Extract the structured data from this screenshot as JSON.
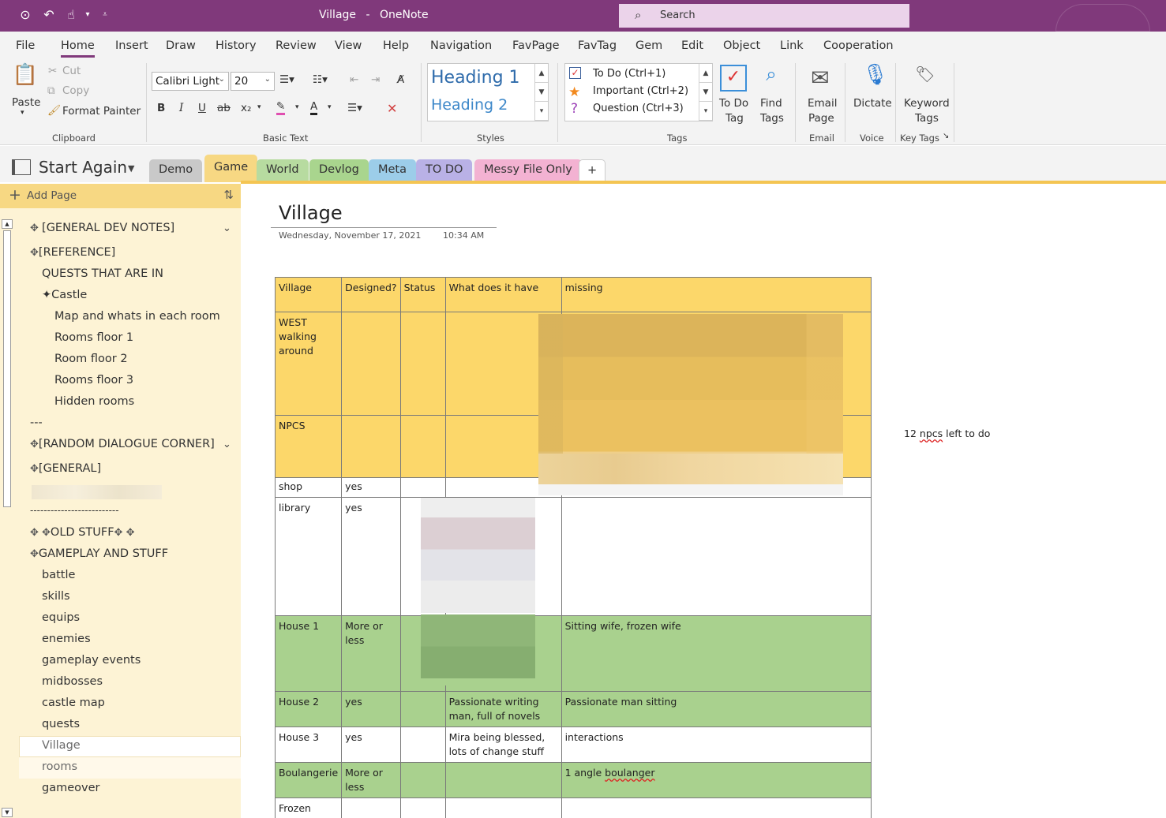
{
  "window": {
    "title": "Village",
    "app": "OneNote",
    "search_placeholder": "Search"
  },
  "ribbon_tabs": [
    "File",
    "Home",
    "Insert",
    "Draw",
    "History",
    "Review",
    "View",
    "Help",
    "Navigation",
    "FavPage",
    "FavTag",
    "Gem",
    "Edit",
    "Object",
    "Link",
    "Cooperation"
  ],
  "active_tab": "Home",
  "clipboard": {
    "paste": "Paste",
    "cut": "Cut",
    "copy": "Copy",
    "format_painter": "Format Painter",
    "label": "Clipboard"
  },
  "basic_text": {
    "font": "Calibri Light",
    "size": "20",
    "bold": "B",
    "italic": "I",
    "underline": "U",
    "strike": "ab",
    "sub": "x₂",
    "label": "Basic Text"
  },
  "styles": {
    "heading1": "Heading 1",
    "heading2": "Heading 2",
    "label": "Styles"
  },
  "tags": {
    "todo": "To Do (Ctrl+1)",
    "important": "Important (Ctrl+2)",
    "question": "Question (Ctrl+3)",
    "todo_tag_line1": "To Do",
    "todo_tag_line2": "Tag",
    "find_tags_line1": "Find",
    "find_tags_line2": "Tags",
    "label": "Tags"
  },
  "email": {
    "line1": "Email",
    "line2": "Page",
    "label": "Email"
  },
  "voice": {
    "dictate": "Dictate",
    "label": "Voice"
  },
  "keytags": {
    "line1": "Keyword",
    "line2": "Tags",
    "label": "Key Tags"
  },
  "notebook": {
    "name": "Start Again"
  },
  "section_tabs": [
    {
      "label": "Demo",
      "color": "#c9c9c9"
    },
    {
      "label": "Game",
      "color": "#f7d883"
    },
    {
      "label": "World",
      "color": "#b7dba0"
    },
    {
      "label": "Devlog",
      "color": "#a9d58e"
    },
    {
      "label": "Meta",
      "color": "#9ccde9"
    },
    {
      "label": "TO DO",
      "color": "#b9b1e6"
    },
    {
      "label": "Messy File Only",
      "color": "#f3b2d2"
    },
    {
      "label": "+",
      "color": "#ffffff"
    }
  ],
  "add_page": "Add Page",
  "pages": [
    "[GENERAL DEV NOTES]",
    "[REFERENCE]",
    "QUESTS THAT ARE IN",
    "✦Castle",
    "Map and whats in each room",
    "Rooms floor 1",
    "Room floor 2",
    "Rooms floor 3",
    "Hidden rooms",
    "---",
    "[RANDOM DIALOGUE CORNER]",
    "[GENERAL]",
    "--------------------------",
    "OLD STUFF",
    "GAMEPLAY AND STUFF",
    "battle",
    "skills",
    "equips",
    "enemies",
    "gameplay events",
    "midbosses",
    "castle map",
    "quests",
    "Village",
    "rooms",
    "gameover"
  ],
  "page": {
    "title": "Village",
    "date": "Wednesday, November 17, 2021",
    "time": "10:34 AM",
    "side_note_pre": "12 ",
    "side_note_squig": "npcs",
    "side_note_post": " left to do"
  },
  "table": {
    "headers": [
      "Village",
      "Designed?",
      "Status",
      "What does it have",
      "missing"
    ],
    "rows": [
      {
        "village": "WEST walking around",
        "designed": "",
        "status": "",
        "has": "",
        "missing": ""
      },
      {
        "village": "NPCS",
        "designed": "",
        "status": "",
        "has": "",
        "missing": ""
      },
      {
        "village": "shop",
        "designed": "yes",
        "status": "",
        "has": "",
        "missing": ""
      },
      {
        "village": "library",
        "designed": "yes",
        "status": "",
        "has": "",
        "missing": ""
      },
      {
        "village": "House 1",
        "designed": "More or less",
        "status": "",
        "has": "",
        "missing": "Sitting wife, frozen wife"
      },
      {
        "village": "House 2",
        "designed": "yes",
        "status": "",
        "has": "Passionate writing man, full of novels",
        "missing": "Passionate man sitting"
      },
      {
        "village": "House 3",
        "designed": "yes",
        "status": "",
        "has": "Mira being blessed, lots of change stuff",
        "missing": "interactions"
      },
      {
        "village": "Boulangerie",
        "designed": "More or less",
        "status": "",
        "has": "",
        "missing_pre": "1 angle ",
        "missing_squig": "boulanger"
      },
      {
        "village": "Frozen house",
        "designed": "",
        "status": "",
        "has": "",
        "missing": ""
      }
    ]
  },
  "colors": {
    "title_bar": "#80397b",
    "row_yellow": "#fcd76a",
    "row_green": "#a9d18e",
    "accent": "#f4c552"
  }
}
